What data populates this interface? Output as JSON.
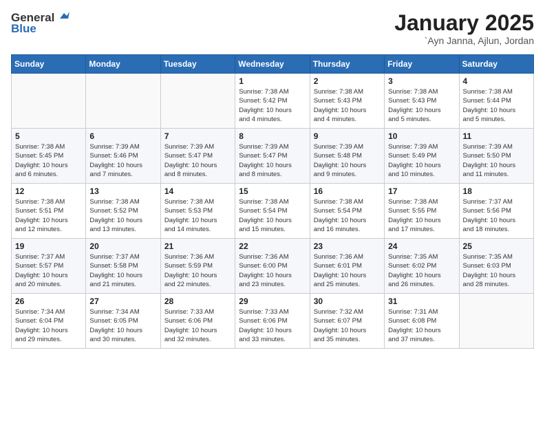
{
  "header": {
    "logo_general": "General",
    "logo_blue": "Blue",
    "month_title": "January 2025",
    "location": "`Ayn Janna, Ajlun, Jordan"
  },
  "days_of_week": [
    "Sunday",
    "Monday",
    "Tuesday",
    "Wednesday",
    "Thursday",
    "Friday",
    "Saturday"
  ],
  "weeks": [
    [
      {
        "num": "",
        "info": ""
      },
      {
        "num": "",
        "info": ""
      },
      {
        "num": "",
        "info": ""
      },
      {
        "num": "1",
        "info": "Sunrise: 7:38 AM\nSunset: 5:42 PM\nDaylight: 10 hours\nand 4 minutes."
      },
      {
        "num": "2",
        "info": "Sunrise: 7:38 AM\nSunset: 5:43 PM\nDaylight: 10 hours\nand 4 minutes."
      },
      {
        "num": "3",
        "info": "Sunrise: 7:38 AM\nSunset: 5:43 PM\nDaylight: 10 hours\nand 5 minutes."
      },
      {
        "num": "4",
        "info": "Sunrise: 7:38 AM\nSunset: 5:44 PM\nDaylight: 10 hours\nand 5 minutes."
      }
    ],
    [
      {
        "num": "5",
        "info": "Sunrise: 7:38 AM\nSunset: 5:45 PM\nDaylight: 10 hours\nand 6 minutes."
      },
      {
        "num": "6",
        "info": "Sunrise: 7:39 AM\nSunset: 5:46 PM\nDaylight: 10 hours\nand 7 minutes."
      },
      {
        "num": "7",
        "info": "Sunrise: 7:39 AM\nSunset: 5:47 PM\nDaylight: 10 hours\nand 8 minutes."
      },
      {
        "num": "8",
        "info": "Sunrise: 7:39 AM\nSunset: 5:47 PM\nDaylight: 10 hours\nand 8 minutes."
      },
      {
        "num": "9",
        "info": "Sunrise: 7:39 AM\nSunset: 5:48 PM\nDaylight: 10 hours\nand 9 minutes."
      },
      {
        "num": "10",
        "info": "Sunrise: 7:39 AM\nSunset: 5:49 PM\nDaylight: 10 hours\nand 10 minutes."
      },
      {
        "num": "11",
        "info": "Sunrise: 7:39 AM\nSunset: 5:50 PM\nDaylight: 10 hours\nand 11 minutes."
      }
    ],
    [
      {
        "num": "12",
        "info": "Sunrise: 7:38 AM\nSunset: 5:51 PM\nDaylight: 10 hours\nand 12 minutes."
      },
      {
        "num": "13",
        "info": "Sunrise: 7:38 AM\nSunset: 5:52 PM\nDaylight: 10 hours\nand 13 minutes."
      },
      {
        "num": "14",
        "info": "Sunrise: 7:38 AM\nSunset: 5:53 PM\nDaylight: 10 hours\nand 14 minutes."
      },
      {
        "num": "15",
        "info": "Sunrise: 7:38 AM\nSunset: 5:54 PM\nDaylight: 10 hours\nand 15 minutes."
      },
      {
        "num": "16",
        "info": "Sunrise: 7:38 AM\nSunset: 5:54 PM\nDaylight: 10 hours\nand 16 minutes."
      },
      {
        "num": "17",
        "info": "Sunrise: 7:38 AM\nSunset: 5:55 PM\nDaylight: 10 hours\nand 17 minutes."
      },
      {
        "num": "18",
        "info": "Sunrise: 7:37 AM\nSunset: 5:56 PM\nDaylight: 10 hours\nand 18 minutes."
      }
    ],
    [
      {
        "num": "19",
        "info": "Sunrise: 7:37 AM\nSunset: 5:57 PM\nDaylight: 10 hours\nand 20 minutes."
      },
      {
        "num": "20",
        "info": "Sunrise: 7:37 AM\nSunset: 5:58 PM\nDaylight: 10 hours\nand 21 minutes."
      },
      {
        "num": "21",
        "info": "Sunrise: 7:36 AM\nSunset: 5:59 PM\nDaylight: 10 hours\nand 22 minutes."
      },
      {
        "num": "22",
        "info": "Sunrise: 7:36 AM\nSunset: 6:00 PM\nDaylight: 10 hours\nand 23 minutes."
      },
      {
        "num": "23",
        "info": "Sunrise: 7:36 AM\nSunset: 6:01 PM\nDaylight: 10 hours\nand 25 minutes."
      },
      {
        "num": "24",
        "info": "Sunrise: 7:35 AM\nSunset: 6:02 PM\nDaylight: 10 hours\nand 26 minutes."
      },
      {
        "num": "25",
        "info": "Sunrise: 7:35 AM\nSunset: 6:03 PM\nDaylight: 10 hours\nand 28 minutes."
      }
    ],
    [
      {
        "num": "26",
        "info": "Sunrise: 7:34 AM\nSunset: 6:04 PM\nDaylight: 10 hours\nand 29 minutes."
      },
      {
        "num": "27",
        "info": "Sunrise: 7:34 AM\nSunset: 6:05 PM\nDaylight: 10 hours\nand 30 minutes."
      },
      {
        "num": "28",
        "info": "Sunrise: 7:33 AM\nSunset: 6:06 PM\nDaylight: 10 hours\nand 32 minutes."
      },
      {
        "num": "29",
        "info": "Sunrise: 7:33 AM\nSunset: 6:06 PM\nDaylight: 10 hours\nand 33 minutes."
      },
      {
        "num": "30",
        "info": "Sunrise: 7:32 AM\nSunset: 6:07 PM\nDaylight: 10 hours\nand 35 minutes."
      },
      {
        "num": "31",
        "info": "Sunrise: 7:31 AM\nSunset: 6:08 PM\nDaylight: 10 hours\nand 37 minutes."
      },
      {
        "num": "",
        "info": ""
      }
    ]
  ]
}
